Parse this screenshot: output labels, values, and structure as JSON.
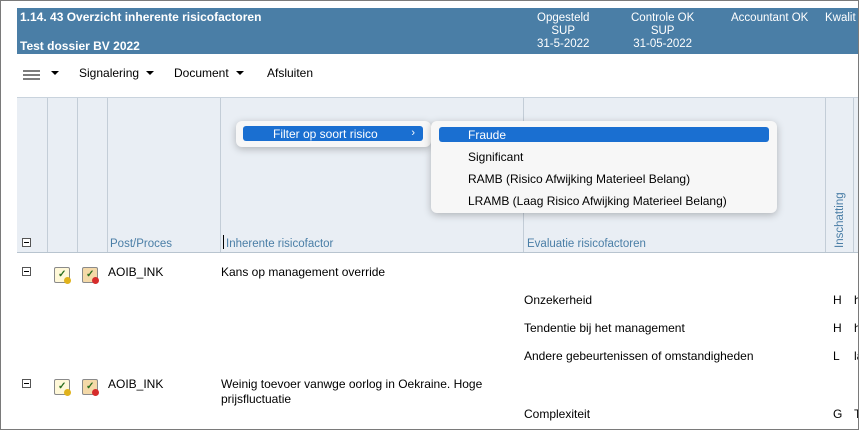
{
  "header": {
    "title": "1.14. 43 Overzicht inherente risicofactoren",
    "dossier": "Test dossier BV 2022",
    "opgesteld": {
      "label": "Opgesteld",
      "by": "SUP",
      "date": "31-5-2022"
    },
    "controle": {
      "label": "Controle OK",
      "by": "SUP",
      "date": "31-05-2022"
    },
    "accountant": {
      "label": "Accountant OK"
    },
    "kwalit": {
      "label": "Kwalit"
    }
  },
  "toolbar": {
    "signalering": "Signalering",
    "document": "Document",
    "afsluiten": "Afsluiten"
  },
  "columns": {
    "post": "Post/Proces",
    "factor": "Inherente risicofactor",
    "evaluatie": "Evaluatie risicofactoren",
    "inschatting": "Inschatting"
  },
  "rows": [
    {
      "post": "AOIB_INK",
      "factor": "Kans op management override",
      "evaluations": [
        {
          "text": "Onzekerheid",
          "code": "H",
          "extra": "h"
        },
        {
          "text": "Tendentie bij het management",
          "code": "H",
          "extra": "h"
        },
        {
          "text": "Andere gebeurtenissen of omstandigheden",
          "code": "L",
          "extra": "la"
        }
      ]
    },
    {
      "post": "AOIB_INK",
      "factor_line1": "Weinig toevoer vanwge oorlog in Oekraine. Hoge",
      "factor_line2": "prijsfluctuatie",
      "evaluations": [
        {
          "text": "Complexiteit",
          "code": "G",
          "extra": "T"
        }
      ]
    }
  ],
  "menu": {
    "parent": "Filter op soort risico",
    "items": [
      "Fraude",
      "Significant",
      "RAMB (Risico Afwijking Materieel Belang)",
      "LRAMB (Laag Risico Afwijking Materieel Belang)"
    ],
    "selected": "Fraude"
  },
  "colors": {
    "header": "#4a7ea6",
    "accent": "#1a6fd1",
    "grid_header": "#e9eef4"
  }
}
